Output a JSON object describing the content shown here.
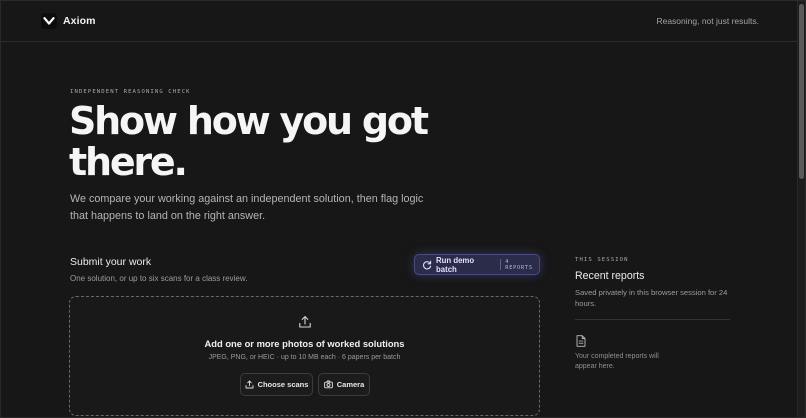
{
  "header": {
    "brand": "Axiom",
    "tagline": "Reasoning, not just results."
  },
  "hero": {
    "eyebrow": "INDEPENDENT REASONING CHECK",
    "title_line1": "Show how you got",
    "title_line2": "there.",
    "subtitle": "We compare your working against an independent solution, then flag logic that happens to land on the right answer."
  },
  "submit": {
    "title": "Submit your work",
    "subtitle": "One solution, or up to six scans for a class review.",
    "demo_button": {
      "label": "Run demo batch",
      "count": "4 REPORTS"
    },
    "dropzone": {
      "title": "Add one or more photos of worked solutions",
      "subtitle": "JPEG, PNG, or HEIC · up to 10 MB each · 6 papers per batch",
      "choose_label": "Choose scans",
      "camera_label": "Camera"
    }
  },
  "session": {
    "eyebrow": "THIS SESSION",
    "title": "Recent reports",
    "subtitle": "Saved privately in this browser session for 24 hours.",
    "empty_text": "Your completed reports will appear here."
  },
  "icons": {
    "logo": "axiom-logo-icon",
    "refresh": "refresh-icon",
    "upload": "upload-icon",
    "camera": "camera-icon",
    "document": "document-icon"
  },
  "colors": {
    "background": "#171717",
    "accent": "#2b2b4a",
    "accent_border": "#4b4b80",
    "text": "#f5f5f5"
  }
}
